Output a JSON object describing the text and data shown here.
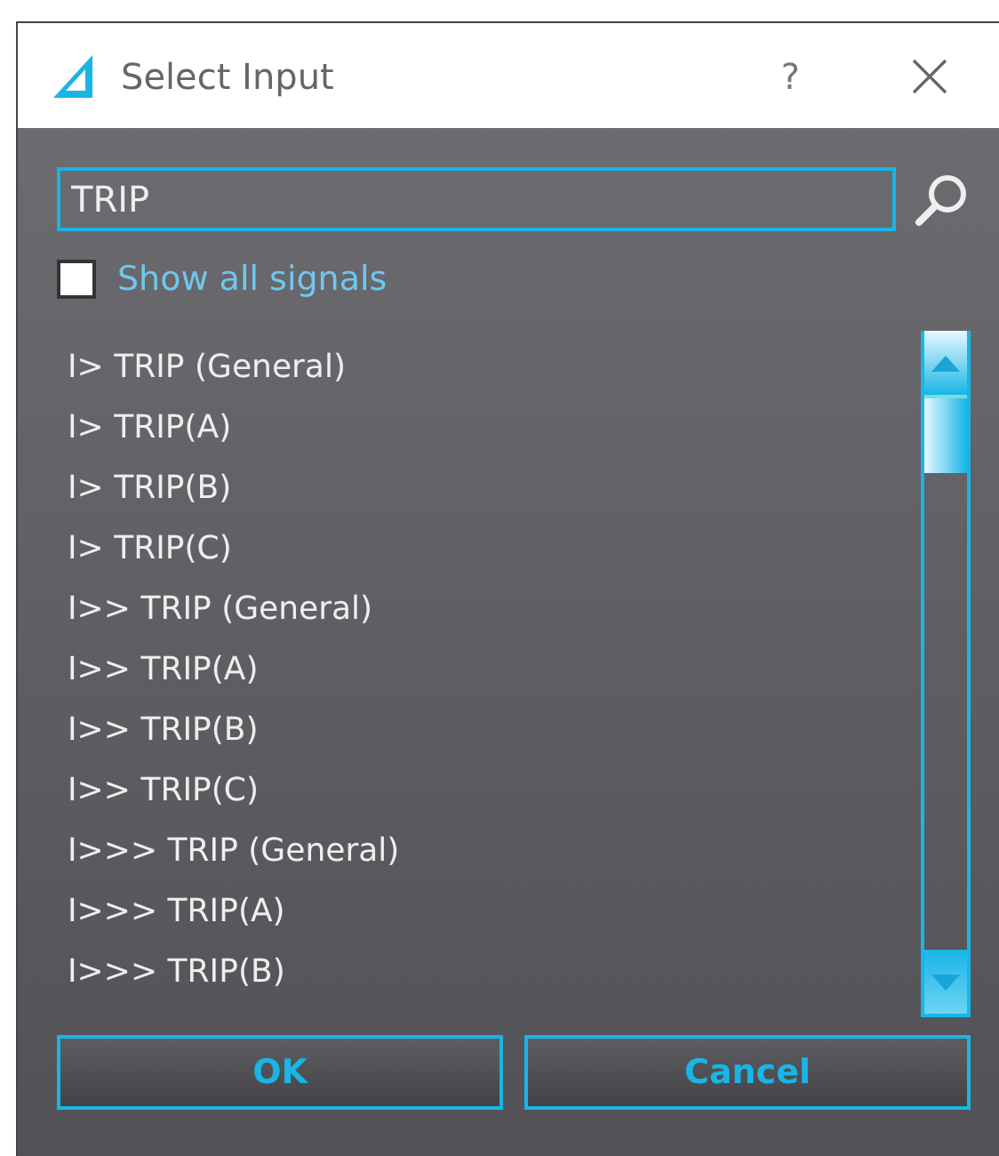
{
  "window": {
    "title": "Select Input",
    "help": "?"
  },
  "search": {
    "value": "TRIP"
  },
  "show_all": {
    "label": "Show all signals",
    "checked": false
  },
  "signals": [
    "I> TRIP (General)",
    "I> TRIP(A)",
    "I> TRIP(B)",
    "I> TRIP(C)",
    "I>> TRIP (General)",
    "I>> TRIP(A)",
    "I>> TRIP(B)",
    "I>> TRIP(C)",
    "I>>> TRIP (General)",
    "I>>> TRIP(A)",
    "I>>> TRIP(B)"
  ],
  "buttons": [
    "OK",
    "Cancel"
  ]
}
